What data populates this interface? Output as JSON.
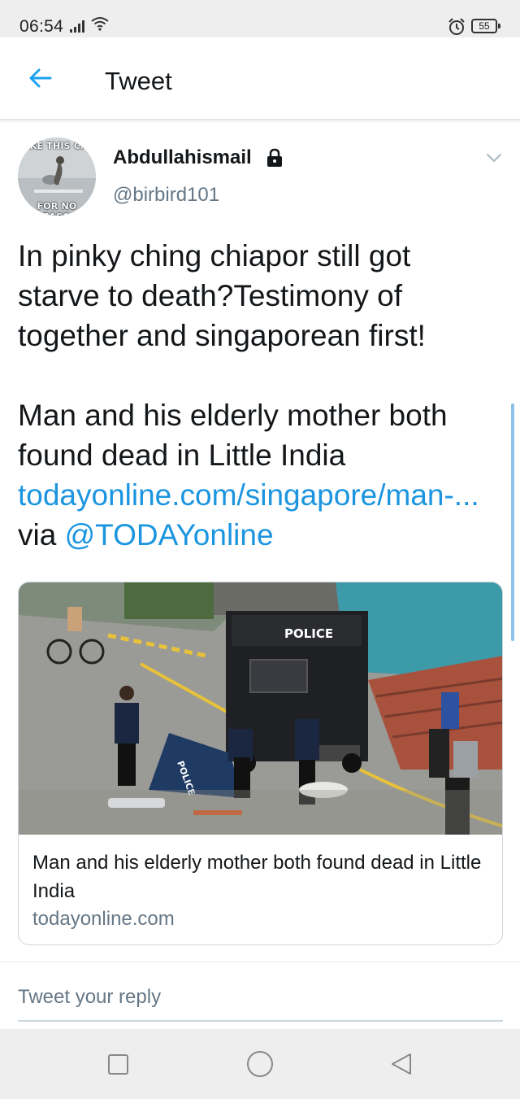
{
  "status_bar": {
    "time": "06:54",
    "battery": "55",
    "icons": [
      "signal-icon",
      "wifi-icon",
      "alarm-icon",
      "battery-icon"
    ]
  },
  "header": {
    "title": "Tweet",
    "back_icon": "arrow-left-icon"
  },
  "tweet": {
    "avatar_text_top": "LIKE THIS CAT",
    "avatar_text_bottom": "FOR NO REASON",
    "display_name": "Abdullahismail",
    "handle": "@birbird101",
    "text_line_1": "In pinky ching chiapor still got starve to death?Testimony of together and singaporean first!",
    "text_line_2": "Man and his elderly mother both found dead in Little India",
    "link_text": "todayonline.com/singapore/man-...",
    "via_text": " via ",
    "mention": "@TODAYonline"
  },
  "card": {
    "image_text": "POLICE",
    "tent_text": "POLICE",
    "title": "Man and his elderly mother both found dead in Little India",
    "domain": "todayonline.com"
  },
  "reply": {
    "placeholder": "Tweet your reply"
  },
  "colors": {
    "link": "#1b95e0",
    "secondary_text": "#657786",
    "primary_text": "#14171a",
    "border": "#ccd6dd"
  }
}
